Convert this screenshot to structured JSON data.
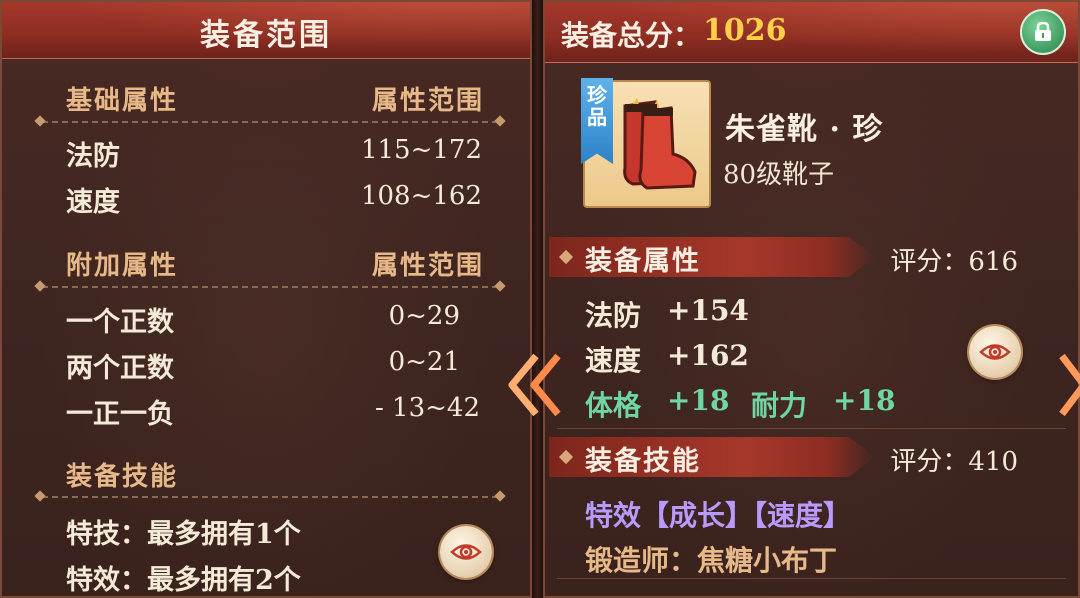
{
  "left": {
    "title": "装备范围",
    "basic": {
      "header": "基础属性",
      "range_header": "属性范围",
      "rows": [
        {
          "label": "法防",
          "value": "115~172"
        },
        {
          "label": "速度",
          "value": "108~162"
        }
      ]
    },
    "extra": {
      "header": "附加属性",
      "range_header": "属性范围",
      "rows": [
        {
          "label": "一个正数",
          "value": "0~29"
        },
        {
          "label": "两个正数",
          "value": "0~21"
        },
        {
          "label": "一正一负",
          "value": "- 13~42"
        }
      ]
    },
    "skills": {
      "header": "装备技能",
      "rows": [
        "特技：最多拥有1个",
        "特效：最多拥有2个"
      ]
    }
  },
  "right": {
    "total_label": "装备总分：",
    "total_value": "1026",
    "item": {
      "rarity": [
        "珍",
        "品"
      ],
      "name": "朱雀靴 · 珍",
      "level": "80级靴子"
    },
    "attributes": {
      "header": "装备属性",
      "score_label": "评分：",
      "score_value": "616",
      "lines": [
        {
          "label": "法防",
          "value": "+154"
        },
        {
          "label": "速度",
          "value": "+162"
        }
      ],
      "extra": [
        {
          "label": "体格",
          "value": "+18"
        },
        {
          "label": "耐力",
          "value": "+18"
        }
      ]
    },
    "skills": {
      "header": "装备技能",
      "score_label": "评分：",
      "score_value": "410",
      "effect": "特效【成长】【速度】",
      "forger": "锻造师：焦糖小布丁"
    }
  },
  "colors": {
    "header_red": "#8e2d22",
    "gold_heading": "#e8b988",
    "score_yellow": "#ffd04a",
    "green_stat": "#6fd6a2",
    "purple_effect": "#b99bff",
    "rarity_blue": "#2c83c7"
  },
  "icons": [
    "eye-icon",
    "lock-icon",
    "double-chevron-left-icon",
    "chevron-right-icon",
    "boots-icon"
  ]
}
